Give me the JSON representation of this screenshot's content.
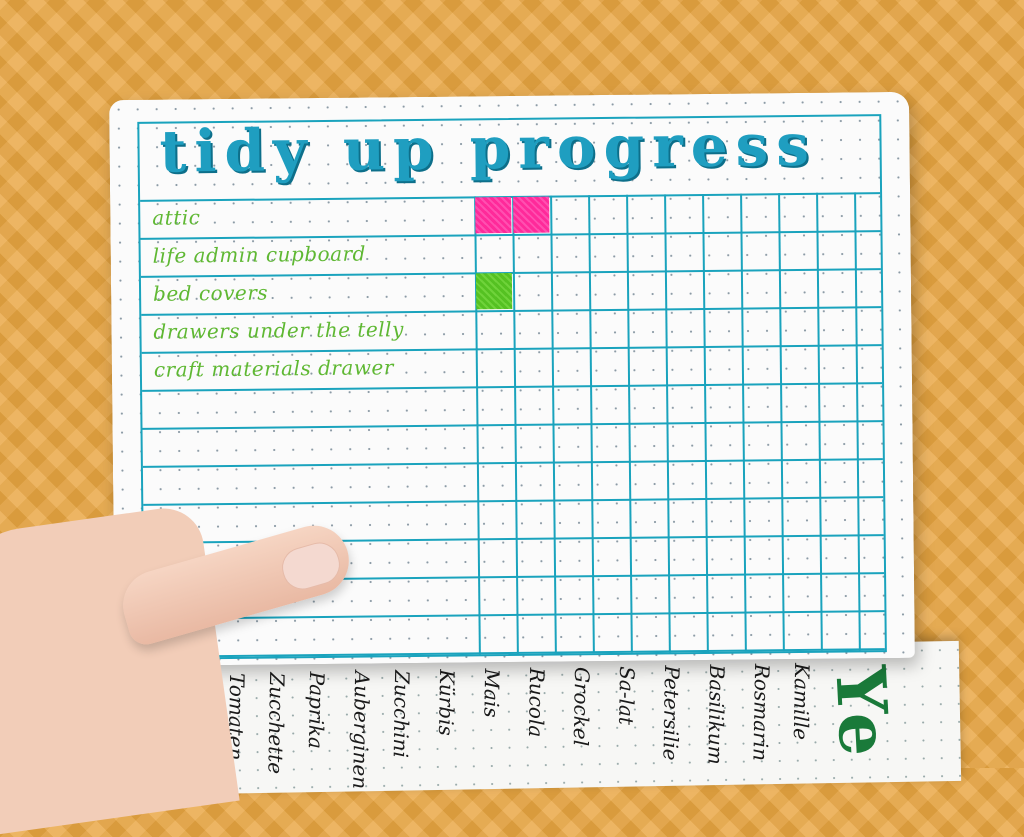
{
  "journal": {
    "title": "tidy up progress",
    "tasks": [
      "attic",
      "life admin cupboard",
      "bed covers",
      "drawers under the telly",
      "craft materials drawer"
    ],
    "progress_cells": [
      {
        "task": "attic",
        "filled": 2,
        "color": "#ff2a9a"
      },
      {
        "task": "bed covers",
        "filled": 1,
        "color": "#55c122"
      }
    ]
  },
  "next_page": {
    "words": [
      "Kamille",
      "Rosmarin",
      "Basilikum",
      "Petersilie",
      "Sa-lat",
      "Grockel",
      "Rucola",
      "Mais",
      "Tomaten",
      "Zucchini",
      "Auberginen",
      "Kürbis",
      "Paprika",
      "Zucchette",
      "Tomaten"
    ],
    "heading_fragment": "Ye"
  },
  "colors": {
    "ink_blue": "#1aa3bd",
    "ink_green": "#5fb833",
    "title_blue": "#1f9ec0",
    "wall_orange": "#e9a642"
  }
}
